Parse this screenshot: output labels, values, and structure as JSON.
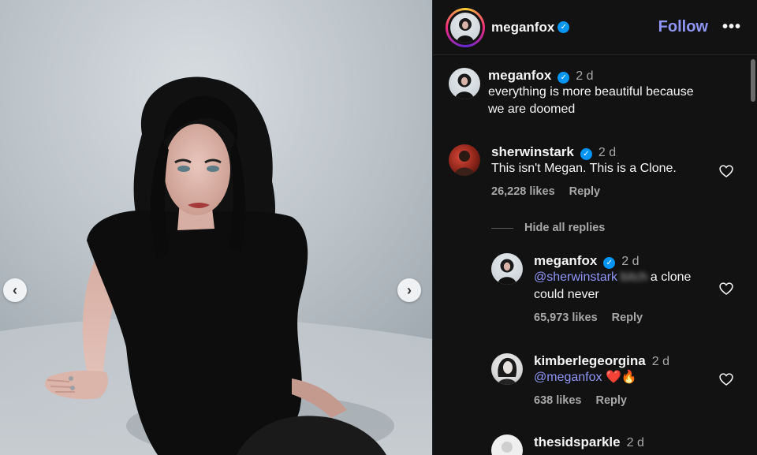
{
  "header": {
    "username": "meganfox",
    "follow_label": "Follow",
    "more_label": "•••"
  },
  "media": {
    "prev_icon": "‹",
    "next_icon": "›"
  },
  "caption": {
    "username": "meganfox",
    "time": "2 d",
    "text_line1": "everything is more beautiful because",
    "text_line2": "we are doomed"
  },
  "comments": [
    {
      "username": "sherwinstark",
      "verified": true,
      "time": "2 d",
      "text": "This isn't Megan. This is a Clone.",
      "likes": "26,228 likes",
      "reply_label": "Reply"
    }
  ],
  "hide_replies_label": "Hide all replies",
  "replies": [
    {
      "username": "meganfox",
      "verified": true,
      "time": "2 d",
      "mention": "@sherwinstark",
      "blurred": "bitch",
      "text_after": "a clone",
      "text_line2": "could never",
      "likes": "65,973 likes",
      "reply_label": "Reply"
    },
    {
      "username": "kimberlegeorgina",
      "time": "2 d",
      "mention": "@meganfox",
      "emoji": "❤️🔥",
      "likes": "638 likes",
      "reply_label": "Reply"
    },
    {
      "username": "thesidsparkle",
      "time": "2 d"
    }
  ],
  "colors": {
    "panel_bg": "#121212",
    "accent_link": "#8f96f6",
    "verified_blue": "#0095f6",
    "muted_text": "#a8a8a8"
  },
  "icons": {
    "verified": "✓",
    "heart": "heart-outline-icon"
  }
}
